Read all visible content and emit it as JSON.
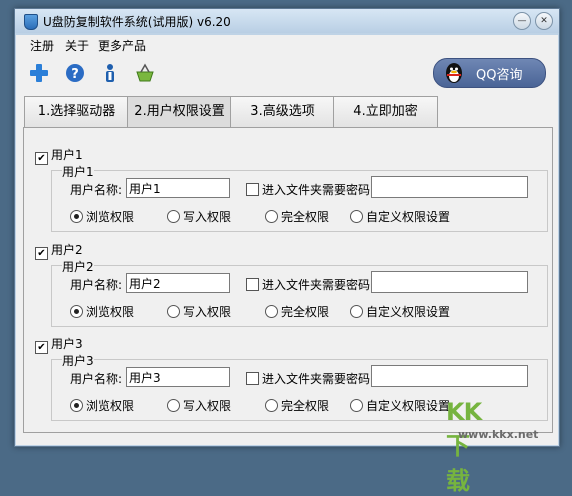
{
  "window": {
    "title": "U盘防复制软件系统(试用版) v6.20"
  },
  "menu": [
    "注册",
    "关于",
    "更多产品"
  ],
  "toolbar_icons": [
    "plus-icon",
    "help-icon",
    "info-icon",
    "basket-icon"
  ],
  "qq_button": {
    "label": "QQ咨询"
  },
  "tabs": [
    "1.选择驱动器",
    "2.用户权限设置",
    "3.高级选项",
    "4.立即加密"
  ],
  "active_tab": 1,
  "users": [
    {
      "check_label": "用户1",
      "group_title": "用户1",
      "name_label": "用户名称:",
      "name_value": "用户1",
      "pwd_check_label": "进入文件夹需要密码",
      "pwd_value": "",
      "radios": [
        "浏览权限",
        "写入权限",
        "完全权限",
        "自定义权限设置"
      ],
      "selected": 0
    },
    {
      "check_label": "用户2",
      "group_title": "用户2",
      "name_label": "用户名称:",
      "name_value": "用户2",
      "pwd_check_label": "进入文件夹需要密码",
      "pwd_value": "",
      "radios": [
        "浏览权限",
        "写入权限",
        "完全权限",
        "自定义权限设置"
      ],
      "selected": 0
    },
    {
      "check_label": "用户3",
      "group_title": "用户3",
      "name_label": "用户名称:",
      "name_value": "用户3",
      "pwd_check_label": "进入文件夹需要密码",
      "pwd_value": "",
      "radios": [
        "浏览权限",
        "写入权限",
        "完全权限",
        "自定义权限设置"
      ],
      "selected": 0
    }
  ],
  "watermark": {
    "logo": "KK下载",
    "url": "www.kkx.net"
  },
  "colors": {
    "accent": "#4a6496",
    "watermark": "#76b43f"
  }
}
